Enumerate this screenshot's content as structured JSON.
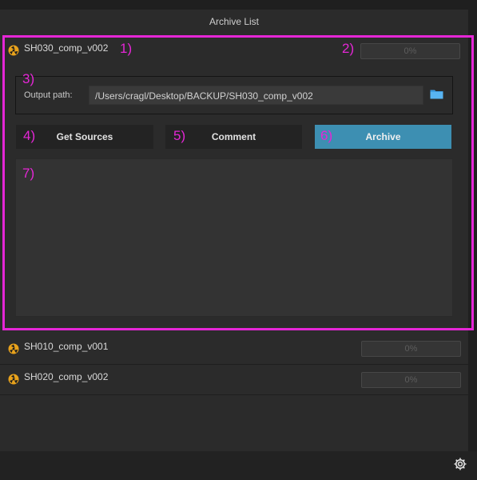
{
  "header": {
    "title": "Archive List"
  },
  "active_shot": {
    "name": "SH030_comp_v002",
    "progress": "0%",
    "output_label": "Output path:",
    "output_path": "/Users/cragl/Desktop/BACKUP/SH030_comp_v002",
    "buttons": {
      "get_sources": "Get Sources",
      "comment": "Comment",
      "archive": "Archive"
    }
  },
  "other_shots": [
    {
      "name": "SH010_comp_v001",
      "progress": "0%"
    },
    {
      "name": "SH020_comp_v002",
      "progress": "0%"
    }
  ],
  "annotations": [
    "1)",
    "2)",
    "3)",
    "4)",
    "5)",
    "6)",
    "7)"
  ],
  "colors": {
    "annotation": "#e526d6",
    "accent": "#3d8fb2"
  },
  "icons": {
    "shot": "nuke-icon",
    "folder": "folder-icon",
    "settings": "gear-icon"
  }
}
